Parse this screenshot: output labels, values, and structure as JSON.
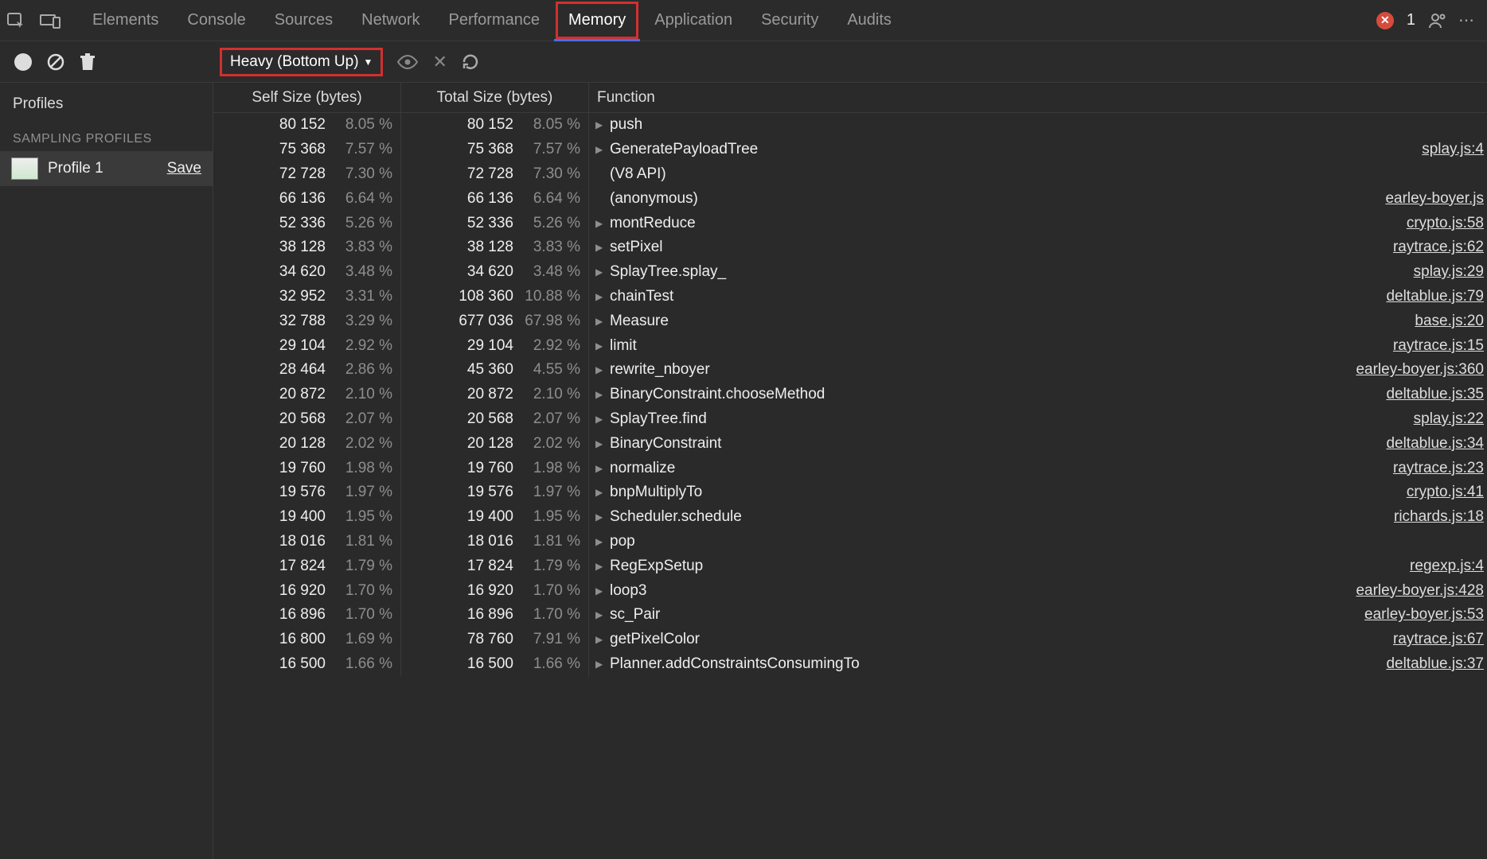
{
  "tabs": [
    "Elements",
    "Console",
    "Sources",
    "Network",
    "Performance",
    "Memory",
    "Application",
    "Security",
    "Audits"
  ],
  "active_tab": "Memory",
  "error_count": "1",
  "toolbar": {
    "view_mode": "Heavy (Bottom Up)"
  },
  "sidebar": {
    "title": "Profiles",
    "subtitle": "SAMPLING PROFILES",
    "profile_name": "Profile 1",
    "save_label": "Save"
  },
  "columns": {
    "self": "Self Size (bytes)",
    "total": "Total Size (bytes)",
    "func": "Function"
  },
  "rows": [
    {
      "self": "80 152",
      "self_pct": "8.05 %",
      "total": "80 152",
      "total_pct": "8.05 %",
      "fn": "push",
      "loc": "",
      "expand": true
    },
    {
      "self": "75 368",
      "self_pct": "7.57 %",
      "total": "75 368",
      "total_pct": "7.57 %",
      "fn": "GeneratePayloadTree",
      "loc": "splay.js:4",
      "expand": true
    },
    {
      "self": "72 728",
      "self_pct": "7.30 %",
      "total": "72 728",
      "total_pct": "7.30 %",
      "fn": "(V8 API)",
      "loc": "",
      "expand": false
    },
    {
      "self": "66 136",
      "self_pct": "6.64 %",
      "total": "66 136",
      "total_pct": "6.64 %",
      "fn": "(anonymous)",
      "loc": "earley-boyer.js",
      "expand": false
    },
    {
      "self": "52 336",
      "self_pct": "5.26 %",
      "total": "52 336",
      "total_pct": "5.26 %",
      "fn": "montReduce",
      "loc": "crypto.js:58",
      "expand": true
    },
    {
      "self": "38 128",
      "self_pct": "3.83 %",
      "total": "38 128",
      "total_pct": "3.83 %",
      "fn": "setPixel",
      "loc": "raytrace.js:62",
      "expand": true
    },
    {
      "self": "34 620",
      "self_pct": "3.48 %",
      "total": "34 620",
      "total_pct": "3.48 %",
      "fn": "SplayTree.splay_",
      "loc": "splay.js:29",
      "expand": true
    },
    {
      "self": "32 952",
      "self_pct": "3.31 %",
      "total": "108 360",
      "total_pct": "10.88 %",
      "fn": "chainTest",
      "loc": "deltablue.js:79",
      "expand": true
    },
    {
      "self": "32 788",
      "self_pct": "3.29 %",
      "total": "677 036",
      "total_pct": "67.98 %",
      "fn": "Measure",
      "loc": "base.js:20",
      "expand": true
    },
    {
      "self": "29 104",
      "self_pct": "2.92 %",
      "total": "29 104",
      "total_pct": "2.92 %",
      "fn": "limit",
      "loc": "raytrace.js:15",
      "expand": true
    },
    {
      "self": "28 464",
      "self_pct": "2.86 %",
      "total": "45 360",
      "total_pct": "4.55 %",
      "fn": "rewrite_nboyer",
      "loc": "earley-boyer.js:360",
      "expand": true
    },
    {
      "self": "20 872",
      "self_pct": "2.10 %",
      "total": "20 872",
      "total_pct": "2.10 %",
      "fn": "BinaryConstraint.chooseMethod",
      "loc": "deltablue.js:35",
      "expand": true
    },
    {
      "self": "20 568",
      "self_pct": "2.07 %",
      "total": "20 568",
      "total_pct": "2.07 %",
      "fn": "SplayTree.find",
      "loc": "splay.js:22",
      "expand": true
    },
    {
      "self": "20 128",
      "self_pct": "2.02 %",
      "total": "20 128",
      "total_pct": "2.02 %",
      "fn": "BinaryConstraint",
      "loc": "deltablue.js:34",
      "expand": true
    },
    {
      "self": "19 760",
      "self_pct": "1.98 %",
      "total": "19 760",
      "total_pct": "1.98 %",
      "fn": "normalize",
      "loc": "raytrace.js:23",
      "expand": true
    },
    {
      "self": "19 576",
      "self_pct": "1.97 %",
      "total": "19 576",
      "total_pct": "1.97 %",
      "fn": "bnpMultiplyTo",
      "loc": "crypto.js:41",
      "expand": true
    },
    {
      "self": "19 400",
      "self_pct": "1.95 %",
      "total": "19 400",
      "total_pct": "1.95 %",
      "fn": "Scheduler.schedule",
      "loc": "richards.js:18",
      "expand": true
    },
    {
      "self": "18 016",
      "self_pct": "1.81 %",
      "total": "18 016",
      "total_pct": "1.81 %",
      "fn": "pop",
      "loc": "",
      "expand": true
    },
    {
      "self": "17 824",
      "self_pct": "1.79 %",
      "total": "17 824",
      "total_pct": "1.79 %",
      "fn": "RegExpSetup",
      "loc": "regexp.js:4",
      "expand": true
    },
    {
      "self": "16 920",
      "self_pct": "1.70 %",
      "total": "16 920",
      "total_pct": "1.70 %",
      "fn": "loop3",
      "loc": "earley-boyer.js:428",
      "expand": true
    },
    {
      "self": "16 896",
      "self_pct": "1.70 %",
      "total": "16 896",
      "total_pct": "1.70 %",
      "fn": "sc_Pair",
      "loc": "earley-boyer.js:53",
      "expand": true
    },
    {
      "self": "16 800",
      "self_pct": "1.69 %",
      "total": "78 760",
      "total_pct": "7.91 %",
      "fn": "getPixelColor",
      "loc": "raytrace.js:67",
      "expand": true
    },
    {
      "self": "16 500",
      "self_pct": "1.66 %",
      "total": "16 500",
      "total_pct": "1.66 %",
      "fn": "Planner.addConstraintsConsumingTo",
      "loc": "deltablue.js:37",
      "expand": true
    }
  ]
}
